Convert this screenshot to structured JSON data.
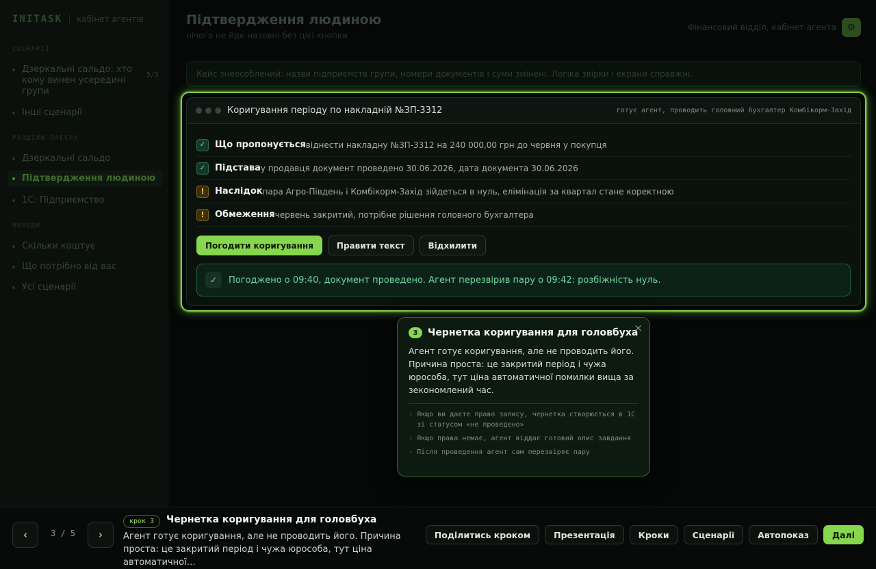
{
  "sidebar": {
    "brand": "INITASK",
    "brand_sub": "кабінет агентів",
    "sections": [
      {
        "title": "СЦЕНАРІЇ",
        "items": [
          {
            "label": "Дзеркальні сальдо: хто кому винен усередині групи",
            "count": "5/5"
          },
          {
            "label": "Інші сценарії"
          }
        ]
      },
      {
        "title": "РОЗДІЛИ ПЛЕЄРА",
        "items": [
          {
            "label": "Дзеркальні сальдо"
          },
          {
            "label": "Підтвердження людиною"
          },
          {
            "label": "1С: Підприємство"
          }
        ]
      },
      {
        "title": "ВИВОДИ",
        "items": [
          {
            "label": "Скільки коштує"
          },
          {
            "label": "Що потрібно від вас"
          },
          {
            "label": "Усі сценарії"
          }
        ]
      }
    ]
  },
  "header": {
    "title": "Підтвердження людиною",
    "subtitle": "нічого не йде назовні без цієї кнопки",
    "context": "Фінансовий відділ, кабінет агента",
    "icon_glyph": "⚙"
  },
  "notice": "Кейс знеособлений: назви підприємств групи, номери документів і суми змінені. Логіка звірки і екрани справжні.",
  "card": {
    "title": "Коригування періоду по накладній №ЗП-3312",
    "meta": "готує агент, проводить головний бухгалтер Комбікорм-Захід",
    "rows": [
      {
        "status": "ok",
        "glyph": "✓",
        "label": "Що пропонується",
        "text": "віднести накладну №ЗП-3312 на 240 000,00 грн до червня у покупця"
      },
      {
        "status": "ok",
        "glyph": "✓",
        "label": "Підстава",
        "text": "у продавця документ проведено 30.06.2026, дата документа 30.06.2026"
      },
      {
        "status": "warn",
        "glyph": "!",
        "label": "Наслідок",
        "text": "пара Агро-Південь і Комбікорм-Захід зійдеться в нуль, елімінація за квартал стане коректною"
      },
      {
        "status": "warn",
        "glyph": "!",
        "label": "Обмеження",
        "text": "червень закритий, потрібне рішення головного бухгалтера"
      }
    ],
    "actions": {
      "approve": "Погодити коригування",
      "edit": "Правити текст",
      "reject": "Відхилити"
    },
    "result_glyph": "✓",
    "result": "Погоджено о 09:40, документ проведено. Агент перезвірив пару о 09:42: розбіжність нуль."
  },
  "popover": {
    "number": "3",
    "title": "Чернетка коригування для головбуха",
    "close_glyph": "×",
    "body": "Агент готує коригування, але не проводить його. Причина проста: це закритий період і чужа юрособа, тут ціна автоматичної помилки вища за зекономлений час.",
    "bullets": [
      "Якщо ви даєте право запису, чернетка створюється в 1С зі статусом «не проведено»",
      "Якщо права немає, агент віддає готовий опис завдання",
      "Після проведення агент сам перезвіряє пару"
    ]
  },
  "bottombar": {
    "prev": "‹",
    "next": "›",
    "counter": "3 / 5",
    "step_chip": "крок 3",
    "title": "Чернетка коригування для головбуха",
    "description": "Агент готує коригування, але не проводить його. Причина проста: це закритий період і чужа юрособа, тут ціна автоматичної…",
    "buttons": {
      "share": "Поділитись кроком",
      "presentation": "Презентація",
      "steps": "Кроки",
      "scenarios": "Сценарії",
      "autoplay": "Автопоказ",
      "next": "Далі"
    }
  },
  "colors": {
    "accent": "#86d74e",
    "success": "#6fd3a0",
    "warning": "#f2c94c",
    "background": "#050806"
  }
}
